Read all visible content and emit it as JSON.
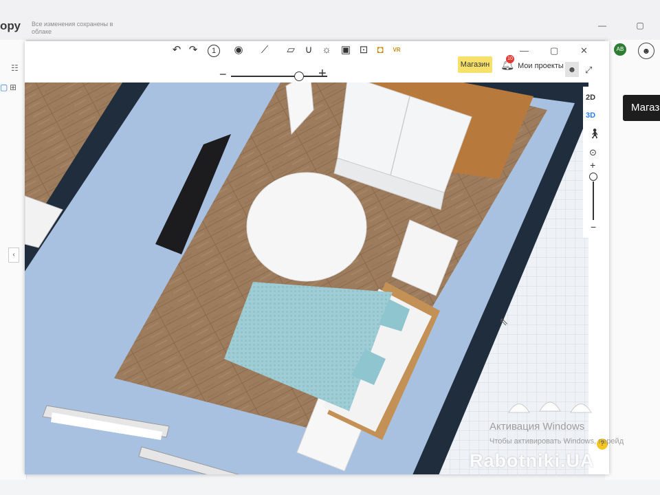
{
  "background_app": {
    "brand_partial": "ору",
    "save_status": "Все изменения сохранены в облаке",
    "shop_button_partial": "Магаз",
    "profile_icon": "user-icon",
    "extension_badge": "AB"
  },
  "planner": {
    "toolbar": {
      "undo_icon": "undo-icon",
      "redo_icon": "redo-icon",
      "floor_selector": "1",
      "shop_label": "Магазин",
      "notification_count": "10",
      "projects_label": "Мои проекты"
    },
    "view_controls": {
      "mode_2d": "2D",
      "mode_3d": "3D",
      "zoom_in": "+",
      "zoom_out": "−",
      "active_mode": "3D"
    },
    "zoom": {
      "minus": "−",
      "plus": "+"
    }
  },
  "watermarks": {
    "windows_activation_title": "Активация Windows",
    "windows_activation_hint": "Чтобы активировать Windows, перейд",
    "site_logo": "Rabotniki.UA"
  },
  "colors": {
    "wall": "#1f2d3d",
    "floor_outer": "#a9c1e0",
    "parquet": "#9b7b5c",
    "bed_blanket": "#9ccdd6",
    "shop_button": "#f7e16b",
    "active_3d": "#2979ff"
  }
}
